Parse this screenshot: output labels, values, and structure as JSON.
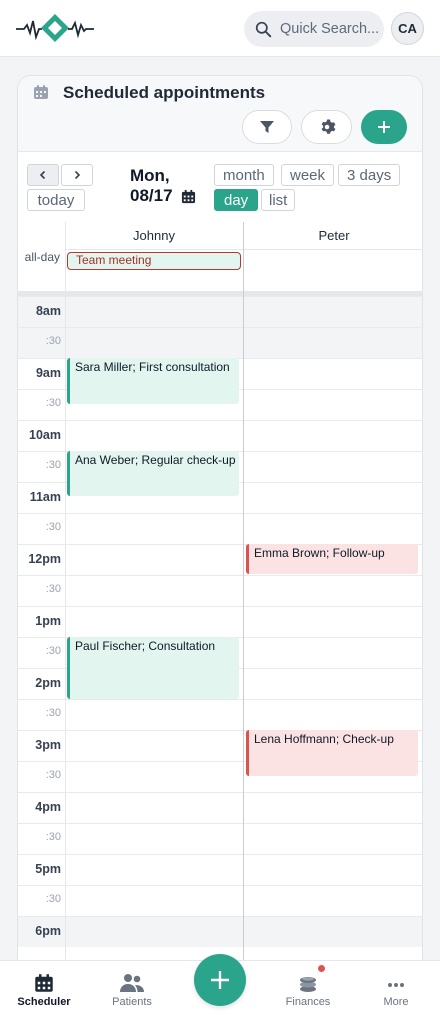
{
  "header": {
    "search_placeholder": "Quick Search...",
    "avatar_initials": "CA"
  },
  "card": {
    "title": "Scheduled appointments"
  },
  "toolbar": {
    "prev_label": "‹",
    "next_label": "›",
    "today_label": "today",
    "date_line1": "Mon,",
    "date_line2": "08/17",
    "views": {
      "month": "month",
      "week": "week",
      "three_days": "3 days",
      "day": "day",
      "list": "list"
    }
  },
  "calendar": {
    "columns": [
      "Johnny",
      "Peter"
    ],
    "allday_label": "all-day",
    "allday_event": "Team meeting",
    "time_labels": [
      "8am",
      ":30",
      "9am",
      ":30",
      "10am",
      ":30",
      "11am",
      ":30",
      "12pm",
      ":30",
      "1pm",
      ":30",
      "2pm",
      ":30",
      "3pm",
      ":30",
      "4pm",
      ":30",
      "5pm",
      ":30",
      "6pm"
    ],
    "events": [
      {
        "title": "Sara Miller; First consultation",
        "resource": "Johnny",
        "color": "green"
      },
      {
        "title": "Ana Weber; Regular check-up",
        "resource": "Johnny",
        "color": "green"
      },
      {
        "title": "Paul Fischer; Consultation",
        "resource": "Johnny",
        "color": "green"
      },
      {
        "title": "Emma Brown; Follow-up",
        "resource": "Peter",
        "color": "red"
      },
      {
        "title": "Lena Hoffmann; Check-up",
        "resource": "Peter",
        "color": "red"
      }
    ]
  },
  "bottom_nav": {
    "scheduler": "Scheduler",
    "patients": "Patients",
    "finances": "Finances",
    "more": "More"
  },
  "colors": {
    "accent": "#2aa58c",
    "event_green_bg": "#e3f5ef",
    "event_red_bg": "#fbe3e3",
    "event_red_border": "#d9534f"
  }
}
